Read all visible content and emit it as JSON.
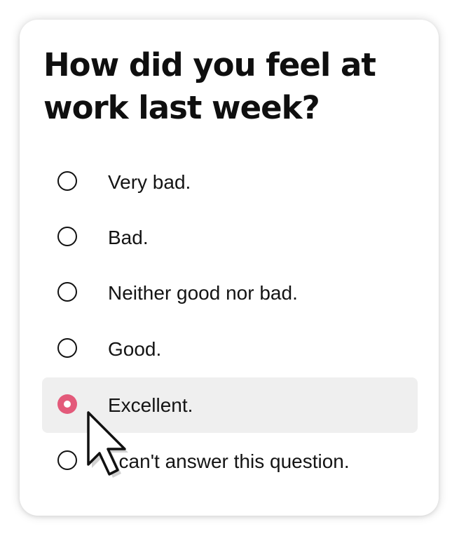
{
  "question": "How did you feel at work last week?",
  "options": [
    {
      "label": "Very bad.",
      "selected": false
    },
    {
      "label": "Bad.",
      "selected": false
    },
    {
      "label": "Neither good nor bad.",
      "selected": false
    },
    {
      "label": "Good.",
      "selected": false
    },
    {
      "label": "Excellent.",
      "selected": true
    },
    {
      "label": "I can't answer this question.",
      "selected": false
    }
  ],
  "colors": {
    "accent": "#e35a7a",
    "selected_row": "#efefef",
    "text": "#141414"
  },
  "icons": {
    "cursor": "mouse-pointer-icon",
    "radio": "radio-button-icon"
  }
}
